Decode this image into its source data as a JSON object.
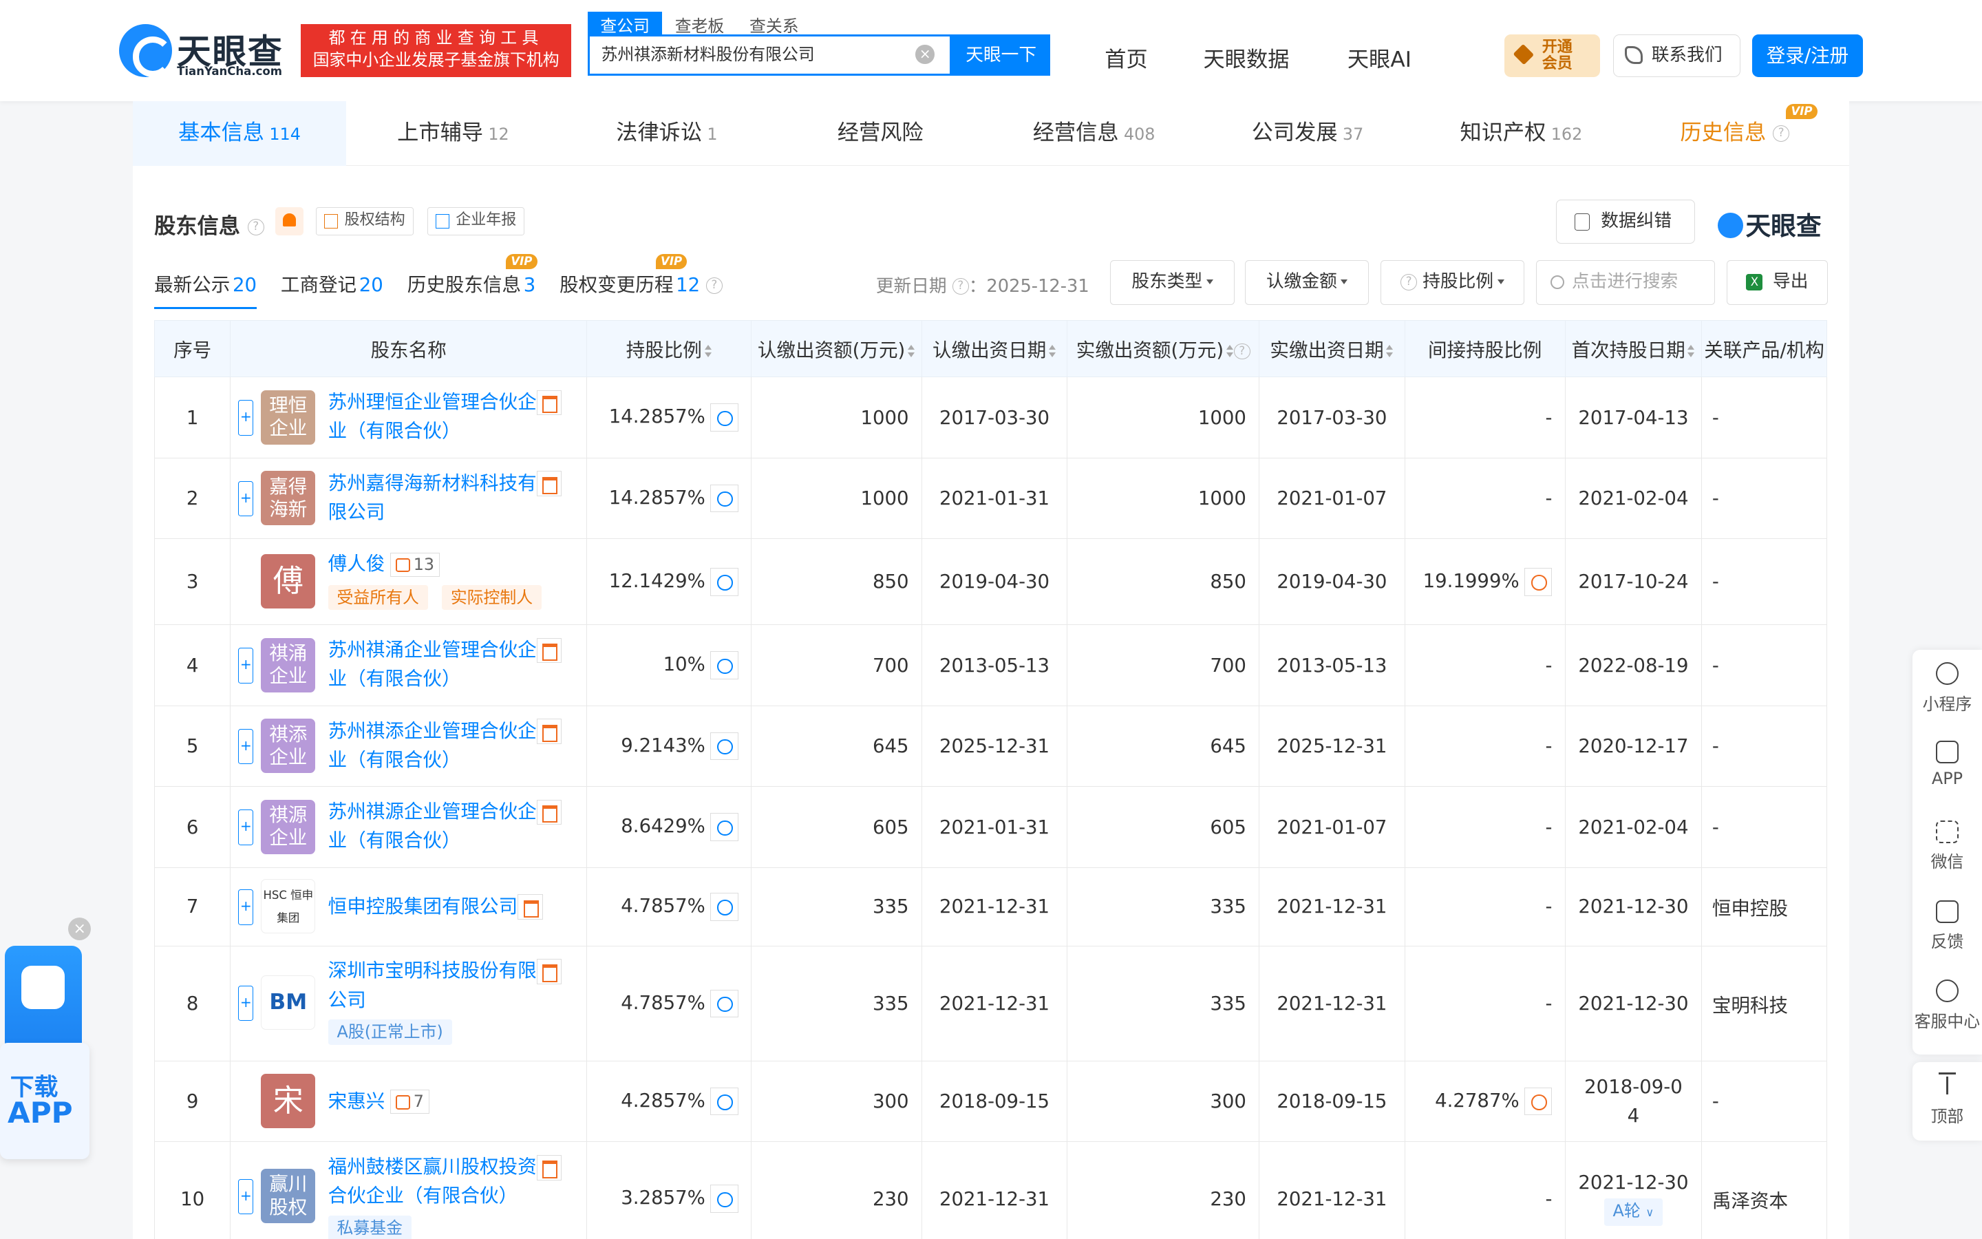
{
  "header": {
    "logo_text": "天眼查",
    "logo_sub": "TianYanCha.com",
    "slogan_line1": "都在用的商业查询工具",
    "slogan_line2": "国家中小企业发展子基金旗下机构",
    "search_tabs": [
      "查公司",
      "查老板",
      "查关系"
    ],
    "search_value": "苏州祺添新材料股份有限公司",
    "search_button": "天眼一下",
    "nav": [
      "首页",
      "天眼数据",
      "天眼AI"
    ],
    "vip_line1": "开通",
    "vip_line2": "会员",
    "contact": "联系我们",
    "login": "登录/注册"
  },
  "content_tabs": [
    {
      "label": "基本信息",
      "count": "114"
    },
    {
      "label": "上市辅导",
      "count": "12"
    },
    {
      "label": "法律诉讼",
      "count": "1"
    },
    {
      "label": "经营风险",
      "count": ""
    },
    {
      "label": "经营信息",
      "count": "408"
    },
    {
      "label": "公司发展",
      "count": "37"
    },
    {
      "label": "知识产权",
      "count": "162"
    },
    {
      "label": "历史信息",
      "count": ""
    }
  ],
  "vip_badge": "VIP",
  "section": {
    "title": "股东信息",
    "btn_structure": "股权结构",
    "btn_report": "企业年报",
    "fix_button": "数据纠错",
    "watermark": "天眼查"
  },
  "subtabs": [
    {
      "label": "最新公示",
      "n": "20"
    },
    {
      "label": "工商登记",
      "n": "20"
    },
    {
      "label": "历史股东信息",
      "n": "3"
    },
    {
      "label": "股权变更历程",
      "n": "12"
    }
  ],
  "toolbar": {
    "update_label": "更新日期",
    "update_value": "：2025-12-31",
    "filter_type": "股东类型",
    "filter_amount": "认缴金额",
    "filter_ratio": "持股比例",
    "search_placeholder": "点击进行搜索",
    "export": "导出"
  },
  "columns": [
    "序号",
    "股东名称",
    "持股比例",
    "认缴出资额(万元)",
    "认缴出资日期",
    "实缴出资额(万元)",
    "实缴出资日期",
    "间接持股比例",
    "首次持股日期",
    "关联产品/机构"
  ],
  "rows": [
    {
      "idx": "1",
      "name_l1": "苏州理恒企业管理合伙企",
      "name_l2": "业（有限合伙）",
      "avatar": "理恒企业",
      "ratio": "14.2857%",
      "sub_amt": "1000",
      "sub_date": "2017-03-30",
      "paid_amt": "1000",
      "paid_date": "2017-03-30",
      "indirect": "-",
      "first": "2017-04-13",
      "rel": "-"
    },
    {
      "idx": "2",
      "name_l1": "苏州嘉得海新材料科技有",
      "name_l2": "限公司",
      "avatar": "嘉得海新",
      "ratio": "14.2857%",
      "sub_amt": "1000",
      "sub_date": "2021-01-31",
      "paid_amt": "1000",
      "paid_date": "2021-01-07",
      "indirect": "-",
      "first": "2021-02-04",
      "rel": "-"
    },
    {
      "idx": "3",
      "name_l1": "傅人俊",
      "avatar": "傅",
      "relcount": "13",
      "tag1": "受益所有人",
      "tag2": "实际控制人",
      "ratio": "12.1429%",
      "sub_amt": "850",
      "sub_date": "2019-04-30",
      "paid_amt": "850",
      "paid_date": "2019-04-30",
      "indirect": "19.1999%",
      "first": "2017-10-24",
      "rel": "-"
    },
    {
      "idx": "4",
      "name_l1": "苏州祺涌企业管理合伙企",
      "name_l2": "业（有限合伙）",
      "avatar": "祺涌企业",
      "ratio": "10%",
      "sub_amt": "700",
      "sub_date": "2013-05-13",
      "paid_amt": "700",
      "paid_date": "2013-05-13",
      "indirect": "-",
      "first": "2022-08-19",
      "rel": "-"
    },
    {
      "idx": "5",
      "name_l1": "苏州祺添企业管理合伙企",
      "name_l2": "业（有限合伙）",
      "avatar": "祺添企业",
      "ratio": "9.2143%",
      "sub_amt": "645",
      "sub_date": "2025-12-31",
      "paid_amt": "645",
      "paid_date": "2025-12-31",
      "indirect": "-",
      "first": "2020-12-17",
      "rel": "-"
    },
    {
      "idx": "6",
      "name_l1": "苏州祺源企业管理合伙企",
      "name_l2": "业（有限合伙）",
      "avatar": "祺源企业",
      "ratio": "8.6429%",
      "sub_amt": "605",
      "sub_date": "2021-01-31",
      "paid_amt": "605",
      "paid_date": "2021-01-07",
      "indirect": "-",
      "first": "2021-02-04",
      "rel": "-"
    },
    {
      "idx": "7",
      "name_l1": "恒申控股集团有限公司",
      "avatar_logo": "HSC 恒申集团",
      "ratio": "4.7857%",
      "sub_amt": "335",
      "sub_date": "2021-12-31",
      "paid_amt": "335",
      "paid_date": "2021-12-31",
      "indirect": "-",
      "first": "2021-12-30",
      "rel": "恒申控股"
    },
    {
      "idx": "8",
      "name_l1": "深圳市宝明科技股份有限",
      "name_l2": "公司",
      "avatar_logo": "BM",
      "tag": "A股(正常上市)",
      "ratio": "4.7857%",
      "sub_amt": "335",
      "sub_date": "2021-12-31",
      "paid_amt": "335",
      "paid_date": "2021-12-31",
      "indirect": "-",
      "first": "2021-12-30",
      "rel": "宝明科技"
    },
    {
      "idx": "9",
      "name_l1": "宋惠兴",
      "avatar": "宋",
      "relcount": "7",
      "ratio": "4.2857%",
      "sub_amt": "300",
      "sub_date": "2018-09-15",
      "paid_amt": "300",
      "paid_date": "2018-09-15",
      "indirect": "4.2787%",
      "first_l1": "2018-09-0",
      "first_l2": "4",
      "rel": "-"
    },
    {
      "idx": "10",
      "name_l1": "福州鼓楼区赢川股权投资",
      "name_l2": "合伙企业（有限合伙）",
      "avatar": "赢川股权",
      "tag": "私募基金",
      "ratio": "3.2857%",
      "sub_amt": "230",
      "sub_date": "2021-12-31",
      "paid_amt": "230",
      "paid_date": "2021-12-31",
      "indirect": "-",
      "first": "2021-12-30",
      "round": "A轮",
      "rel": "禹泽资本"
    }
  ],
  "right_bar": [
    "小程序",
    "APP",
    "微信",
    "反馈",
    "客服中心"
  ],
  "top_button": "顶部",
  "app_download": {
    "line1": "下载",
    "line2": "APP"
  },
  "colors": {
    "brand_blue": "#0084ff",
    "slogan_red": "#e8332a",
    "vip_orange": "#e8880e"
  }
}
